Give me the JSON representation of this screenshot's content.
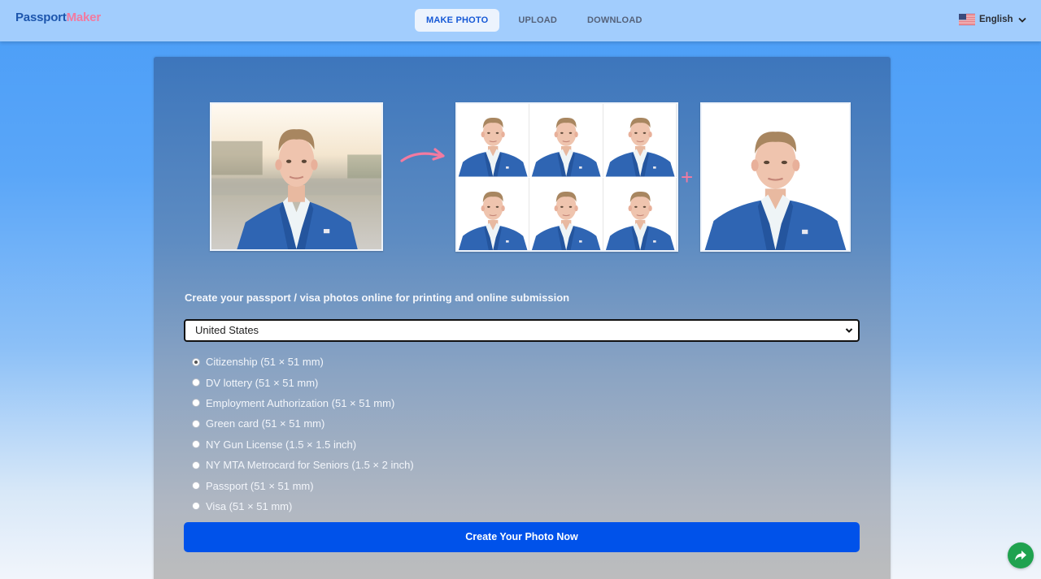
{
  "header": {
    "logo": {
      "part1": "Passport",
      "part2": "Maker"
    },
    "nav": [
      {
        "label": "MAKE PHOTO",
        "active": true
      },
      {
        "label": "UPLOAD",
        "active": false
      },
      {
        "label": "DOWNLOAD",
        "active": false
      }
    ],
    "language": {
      "label": "English",
      "icon": "us-flag-icon"
    }
  },
  "main": {
    "preview": {
      "original_alt": "Original photo",
      "arrow_icon": "curved-arrow-icon",
      "sheet_count": 6,
      "plus_symbol": "+"
    },
    "tagline": "Create your passport / visa photos online for printing and online submission",
    "country": {
      "selected": "United States"
    },
    "documents": [
      {
        "label": "Citizenship (51 × 51 mm)",
        "selected": true
      },
      {
        "label": "DV lottery (51 × 51 mm)",
        "selected": false
      },
      {
        "label": "Employment Authorization (51 × 51 mm)",
        "selected": false
      },
      {
        "label": "Green card (51 × 51 mm)",
        "selected": false
      },
      {
        "label": "NY Gun License (1.5 × 1.5 inch)",
        "selected": false
      },
      {
        "label": "NY MTA Metrocard for Seniors (1.5 × 2 inch)",
        "selected": false
      },
      {
        "label": "Passport (51 × 51 mm)",
        "selected": false
      },
      {
        "label": "Visa (51 × 51 mm)",
        "selected": false
      }
    ],
    "create_button": "Create Your Photo Now"
  },
  "floating": {
    "share_icon": "share-arrow-icon"
  },
  "colors": {
    "brand_blue": "#1d56ad",
    "brand_pink": "#f27aa0",
    "primary_button": "#0052ea",
    "share_button": "#1fa24f",
    "header_bg": "#a2cdfd"
  }
}
